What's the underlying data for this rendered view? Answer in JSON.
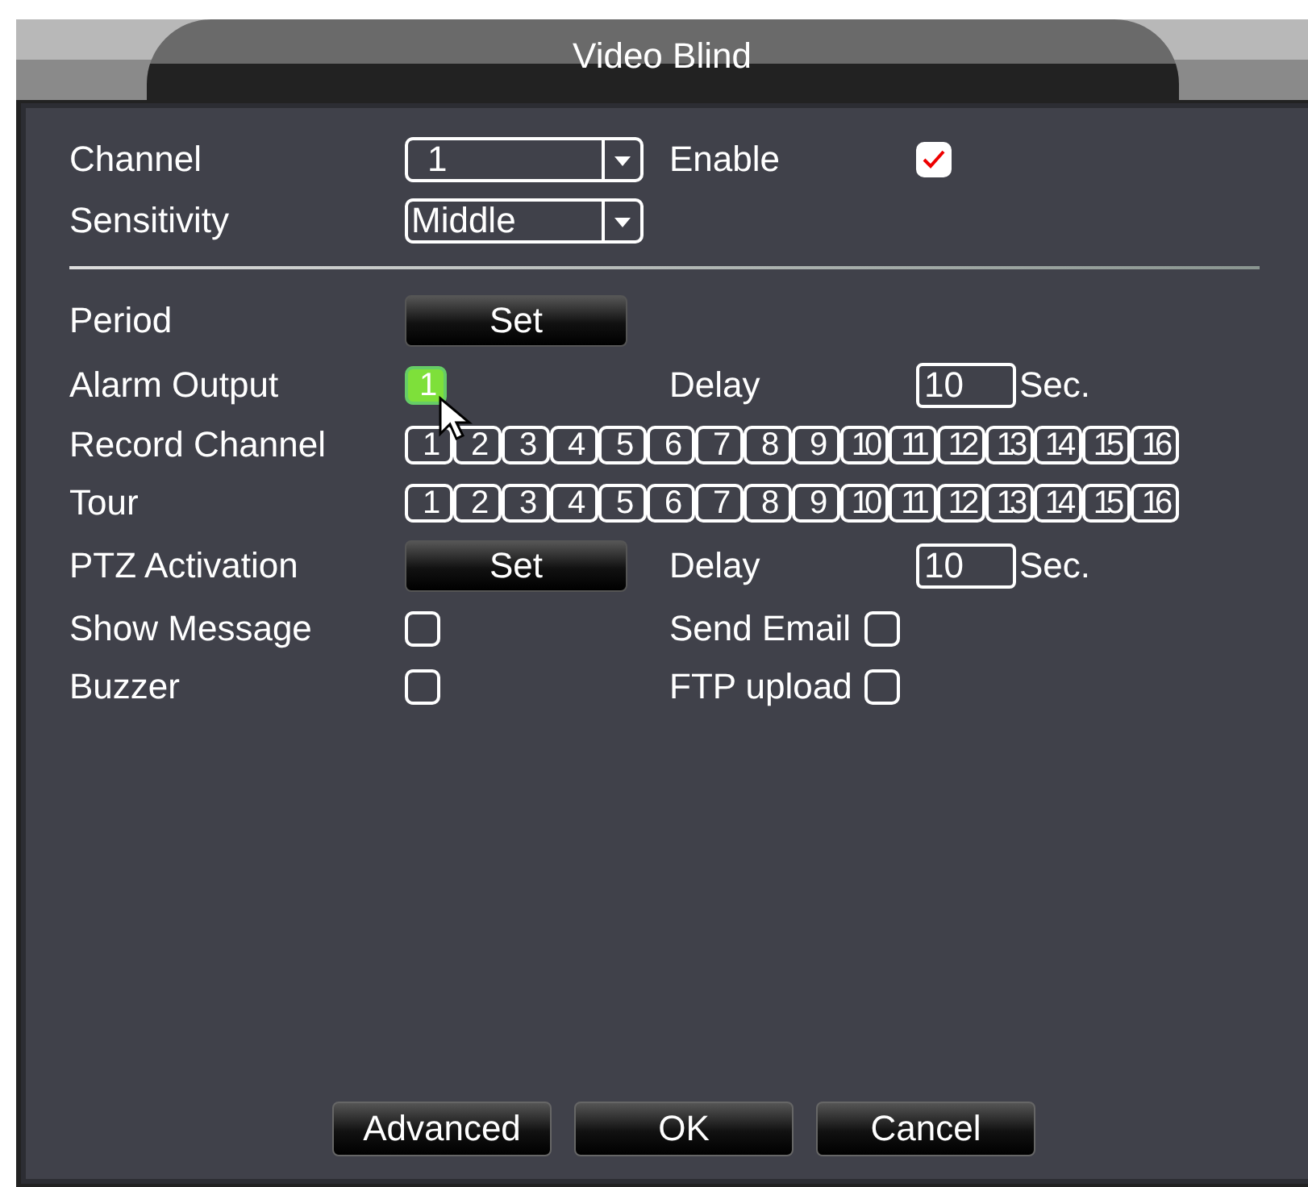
{
  "window": {
    "title": "Video Blind"
  },
  "channel": {
    "label": "Channel",
    "value": "1"
  },
  "enable": {
    "label": "Enable",
    "checked": true
  },
  "sensitivity": {
    "label": "Sensitivity",
    "value": "Middle"
  },
  "period": {
    "label": "Period",
    "button": "Set"
  },
  "alarm_output": {
    "label": "Alarm Output",
    "outputs": [
      {
        "label": "1",
        "selected": true
      }
    ],
    "delay_label": "Delay",
    "delay": "10",
    "unit": "Sec."
  },
  "record_channel": {
    "label": "Record Channel",
    "channels": [
      {
        "label": "1",
        "selected": false
      },
      {
        "label": "2",
        "selected": false
      },
      {
        "label": "3",
        "selected": false
      },
      {
        "label": "4",
        "selected": false
      },
      {
        "label": "5",
        "selected": false
      },
      {
        "label": "6",
        "selected": false
      },
      {
        "label": "7",
        "selected": false
      },
      {
        "label": "8",
        "selected": false
      },
      {
        "label": "9",
        "selected": false
      },
      {
        "label": "10",
        "selected": false
      },
      {
        "label": "11",
        "selected": false
      },
      {
        "label": "12",
        "selected": false
      },
      {
        "label": "13",
        "selected": false
      },
      {
        "label": "14",
        "selected": false
      },
      {
        "label": "15",
        "selected": false
      },
      {
        "label": "16",
        "selected": false
      }
    ]
  },
  "tour": {
    "label": "Tour",
    "channels": [
      {
        "label": "1",
        "selected": false
      },
      {
        "label": "2",
        "selected": false
      },
      {
        "label": "3",
        "selected": false
      },
      {
        "label": "4",
        "selected": false
      },
      {
        "label": "5",
        "selected": false
      },
      {
        "label": "6",
        "selected": false
      },
      {
        "label": "7",
        "selected": false
      },
      {
        "label": "8",
        "selected": false
      },
      {
        "label": "9",
        "selected": false
      },
      {
        "label": "10",
        "selected": false
      },
      {
        "label": "11",
        "selected": false
      },
      {
        "label": "12",
        "selected": false
      },
      {
        "label": "13",
        "selected": false
      },
      {
        "label": "14",
        "selected": false
      },
      {
        "label": "15",
        "selected": false
      },
      {
        "label": "16",
        "selected": false
      }
    ]
  },
  "ptz_activation": {
    "label": "PTZ Activation",
    "button": "Set",
    "delay_label": "Delay",
    "delay": "10",
    "unit": "Sec."
  },
  "options": [
    {
      "label": "Show Message",
      "checked": false
    },
    {
      "label": "Send Email",
      "checked": false
    },
    {
      "label": "Buzzer",
      "checked": false
    },
    {
      "label": "FTP upload",
      "checked": false
    }
  ],
  "buttons": [
    "Advanced",
    "OK",
    "Cancel"
  ]
}
